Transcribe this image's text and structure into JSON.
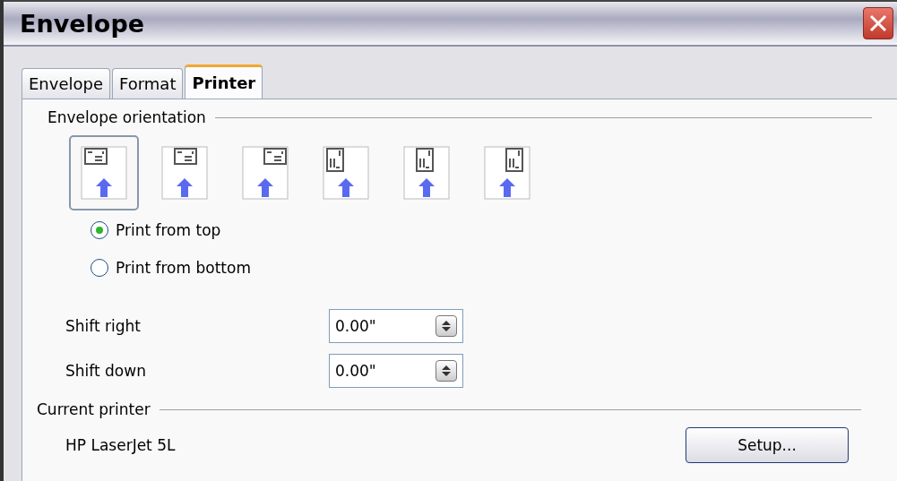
{
  "window": {
    "title": "Envelope"
  },
  "tabs": [
    {
      "label": "Envelope",
      "selected": false
    },
    {
      "label": "Format",
      "selected": false
    },
    {
      "label": "Printer",
      "selected": true
    }
  ],
  "orientation": {
    "heading": "Envelope orientation",
    "options": [
      {
        "kind": "horizontal-left",
        "selected": true
      },
      {
        "kind": "horizontal-center",
        "selected": false
      },
      {
        "kind": "horizontal-right",
        "selected": false
      },
      {
        "kind": "vertical-left",
        "selected": false
      },
      {
        "kind": "vertical-center",
        "selected": false
      },
      {
        "kind": "vertical-right",
        "selected": false
      }
    ],
    "radios": [
      {
        "label": "Print from top",
        "selected": true
      },
      {
        "label": "Print from bottom",
        "selected": false
      }
    ]
  },
  "shifts": [
    {
      "label": "Shift right",
      "value": "0.00\""
    },
    {
      "label": "Shift down",
      "value": "0.00\""
    }
  ],
  "current_printer": {
    "heading": "Current printer",
    "name": "HP LaserJet 5L",
    "button": "Setup..."
  }
}
